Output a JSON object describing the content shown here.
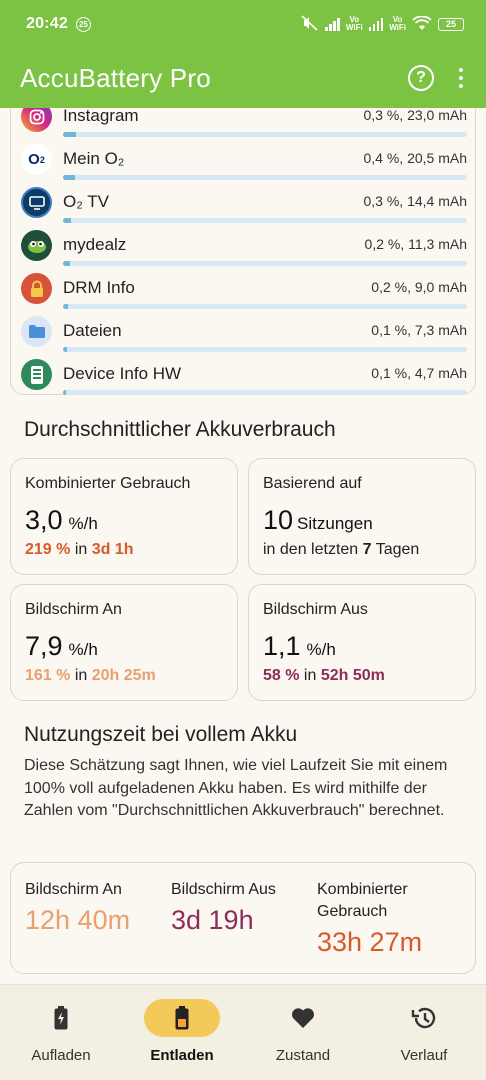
{
  "status_bar": {
    "time": "20:42",
    "notification_count": "25",
    "wifi_label_1": "Vo\nWiFi",
    "wifi_label_2": "Vo\nWiFi",
    "battery_level": "25"
  },
  "app_bar": {
    "title": "AccuBattery Pro",
    "help_icon": "help-circle-icon",
    "more_icon": "more-vert-icon"
  },
  "apps": [
    {
      "name": "Instagram",
      "value": "0,3 %, 23,0 mAh",
      "share": 0.03,
      "icon": "instagram-icon",
      "color": "#d6287c"
    },
    {
      "name": "Mein O₂",
      "value": "0,4 %, 20,5 mAh",
      "share": 0.027,
      "icon": "o2-icon",
      "color": "#ffffff"
    },
    {
      "name": "O₂ TV",
      "value": "0,3 %, 14,4 mAh",
      "share": 0.019,
      "icon": "tv-icon",
      "color": "#0d3b66"
    },
    {
      "name": "mydealz",
      "value": "0,2 %, 11,3 mAh",
      "share": 0.015,
      "icon": "mydealz-icon",
      "color": "#1f4f3a"
    },
    {
      "name": "DRM Info",
      "value": "0,2 %, 9,0 mAh",
      "share": 0.012,
      "icon": "lock-icon",
      "color": "#d9533a"
    },
    {
      "name": "Dateien",
      "value": "0,1 %, 7,3 mAh",
      "share": 0.01,
      "icon": "folder-icon",
      "color": "#4a90d9"
    },
    {
      "name": "Device Info HW",
      "value": "0,1 %, 4,7 mAh",
      "share": 0.007,
      "icon": "device-info-icon",
      "color": "#2e8a5a"
    }
  ],
  "avg_usage": {
    "title": "Durchschnittlicher Akkuverbrauch",
    "combined": {
      "label": "Kombinierter Gebrauch",
      "value": "3,0",
      "unit": "%/h",
      "pct": "219 %",
      "in": "in",
      "dur": "3d 1h"
    },
    "based_on": {
      "label": "Basierend auf",
      "value": "10",
      "unit": "Sitzungen",
      "line_prefix": "in den letzten",
      "days": "7",
      "line_suffix": "Tagen"
    },
    "screen_on": {
      "label": "Bildschirm An",
      "value": "7,9",
      "unit": "%/h",
      "pct": "161 %",
      "in": "in",
      "dur": "20h 25m"
    },
    "screen_off": {
      "label": "Bildschirm Aus",
      "value": "1,1",
      "unit": "%/h",
      "pct": "58 %",
      "in": "in",
      "dur": "52h 50m"
    }
  },
  "full_battery": {
    "title": "Nutzungszeit bei vollem Akku",
    "description": "Diese Schätzung sagt Ihnen, wie viel Laufzeit Sie mit einem 100% voll aufgeladenen Akku haben. Es wird mithilfe der Zahlen vom \"Durchschnittlichen Akkuverbrauch\" berechnet.",
    "screen_on": {
      "label": "Bildschirm An",
      "value": "12h 40m"
    },
    "screen_off": {
      "label": "Bildschirm Aus",
      "value": "3d 19h"
    },
    "combined": {
      "label": "Kombinierter Gebrauch",
      "value": "33h 27m"
    }
  },
  "colors": {
    "accent_green": "#7cc243",
    "red": "#d85a2a",
    "orange": "#e8a070",
    "purple": "#8c2d5a",
    "nav_active": "#f3c95a",
    "bar": "#6fb6dc"
  },
  "bottom_nav": [
    {
      "label": "Aufladen",
      "icon": "battery-charging-icon",
      "active": false
    },
    {
      "label": "Entladen",
      "icon": "battery-discharge-icon",
      "active": true
    },
    {
      "label": "Zustand",
      "icon": "heart-icon",
      "active": false
    },
    {
      "label": "Verlauf",
      "icon": "history-icon",
      "active": false
    }
  ]
}
